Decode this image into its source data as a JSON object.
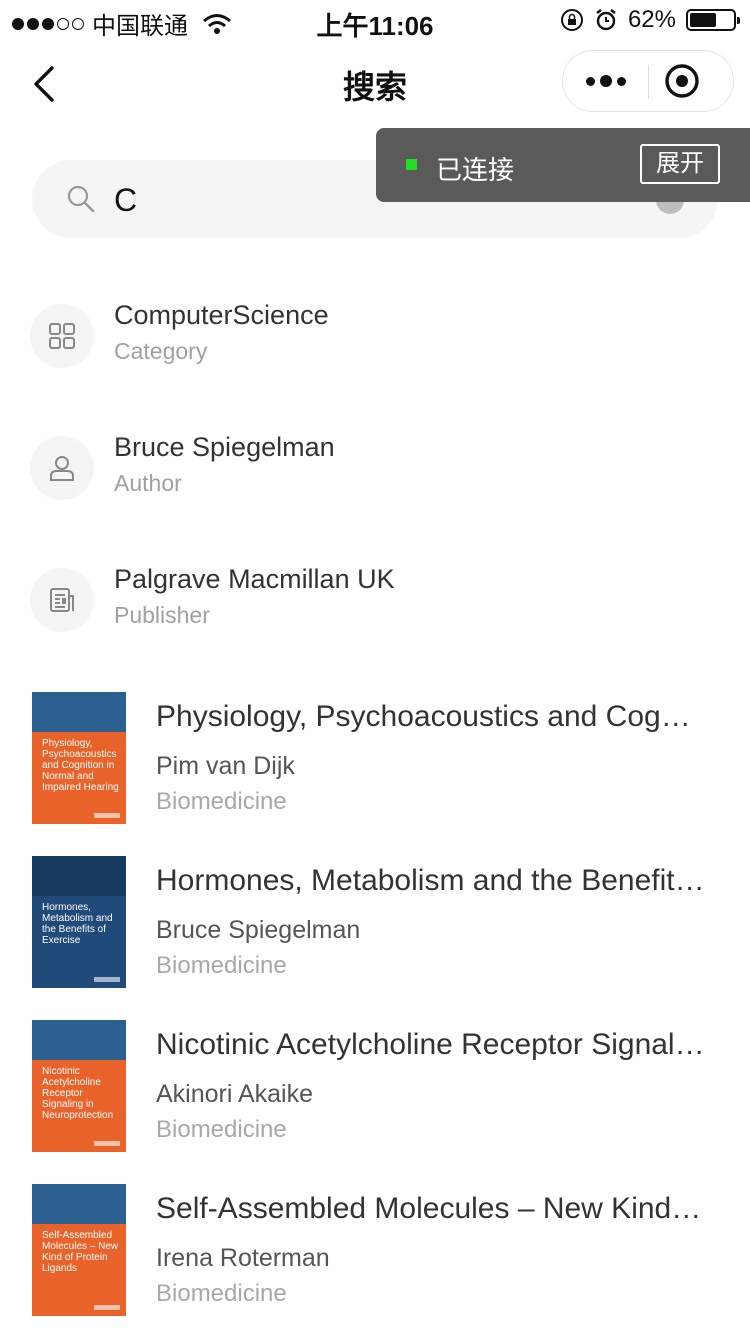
{
  "status_bar": {
    "carrier": "中国联通",
    "time": "上午11:06",
    "battery": "62%",
    "battery_level": 0.62
  },
  "nav": {
    "title": "搜索"
  },
  "toast": {
    "text": "已连接",
    "button": "展开"
  },
  "search": {
    "value": "C"
  },
  "suggestions": [
    {
      "title": "ComputerScience",
      "subtitle": "Category",
      "icon": "category-grid-icon"
    },
    {
      "title": "Bruce Spiegelman",
      "subtitle": "Author",
      "icon": "person-icon"
    },
    {
      "title": "Palgrave Macmillan UK",
      "subtitle": "Publisher",
      "icon": "publisher-document-icon"
    }
  ],
  "books": [
    {
      "title": "Physiology, Psychoacoustics and Cognition in Normal and Impaired Hearing",
      "author": "Pim van Dijk",
      "category": "Biomedicine",
      "cover_text": "Physiology, Psychoacoustics and Cognition in Normal and Impaired Hearing",
      "cover_color": "#e8622a",
      "cover_top": "#2a5f8f"
    },
    {
      "title": "Hormones, Metabolism and the Benefits of Exercise",
      "author": "Bruce Spiegelman",
      "category": "Biomedicine",
      "cover_text": "Hormones, Metabolism and the Benefits of Exercise",
      "cover_color": "#1f4a7a",
      "cover_top": "#16395e"
    },
    {
      "title": "Nicotinic Acetylcholine Receptor Signaling in Neuroprotection",
      "author": "Akinori Akaike",
      "category": "Biomedicine",
      "cover_text": "Nicotinic Acetylcholine Receptor Signaling in Neuroprotection",
      "cover_color": "#e8622a",
      "cover_top": "#2a5f8f"
    },
    {
      "title": "Self-Assembled Molecules – New Kind of Protein Ligands",
      "author": "Irena Roterman",
      "category": "Biomedicine",
      "cover_text": "Self-Assembled Molecules – New Kind of Protein Ligands",
      "cover_color": "#e8622a",
      "cover_top": "#2a5f8f"
    }
  ]
}
